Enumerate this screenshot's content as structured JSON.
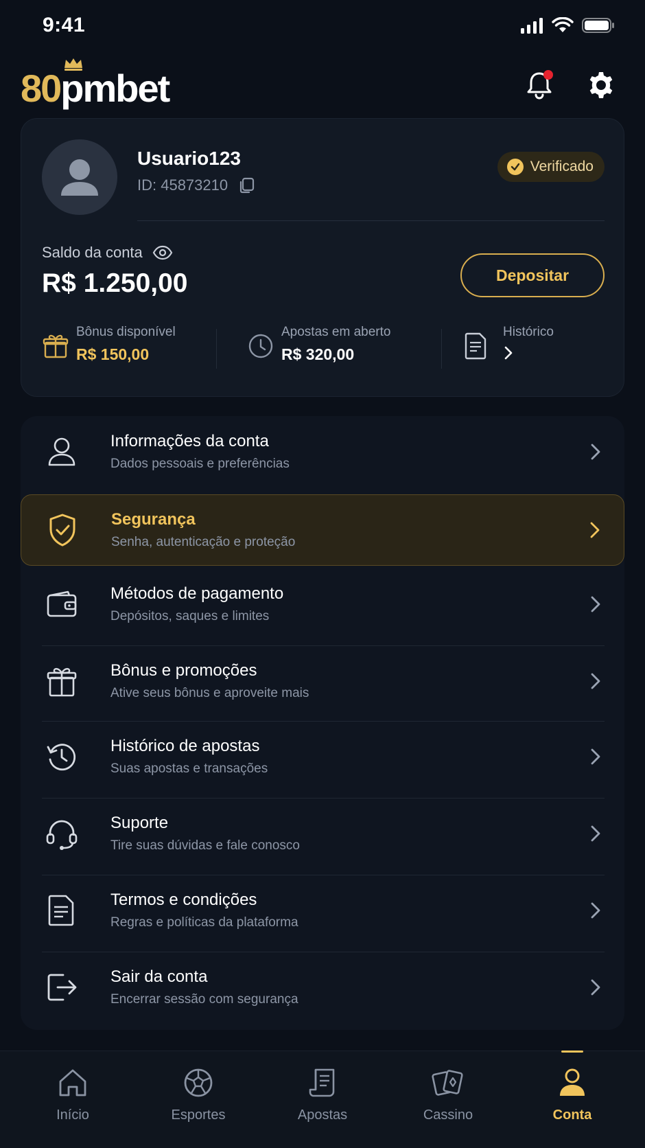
{
  "status_bar": {
    "time": "9:41"
  },
  "header": {
    "logo_num": "80",
    "logo_rest": "pmbet",
    "icons": [
      "bell-icon",
      "gear-icon"
    ],
    "notification_dot_color": "#e5232f"
  },
  "profile": {
    "username": "Usuario123",
    "id_text": "ID: 45873210",
    "verified_label": "Verificado",
    "balance_label": "Saldo da conta",
    "balance_value": "R$ 1.250,00",
    "deposit_label": "Depositar",
    "stats": [
      {
        "label": "Bônus disponível",
        "value": "R$ 150,00",
        "icon": "gift-icon"
      },
      {
        "label": "Apostas em aberto",
        "value": "R$ 320,00",
        "icon": "clock-icon"
      },
      {
        "label": "Histórico",
        "value": "",
        "icon": "document-icon"
      }
    ]
  },
  "menu": {
    "items": [
      {
        "title": "Informações da conta",
        "subtitle": "Dados pessoais e preferências",
        "icon": "user-icon",
        "active": false
      },
      {
        "title": "Segurança",
        "subtitle": "Senha, autenticação e proteção",
        "icon": "shield-check-icon",
        "active": true
      },
      {
        "title": "Métodos de pagamento",
        "subtitle": "Depósitos, saques e limites",
        "icon": "wallet-icon",
        "active": false
      },
      {
        "title": "Bônus e promoções",
        "subtitle": "Ative seus bônus e aproveite mais",
        "icon": "gift-icon",
        "active": false
      },
      {
        "title": "Histórico de apostas",
        "subtitle": "Suas apostas e transações",
        "icon": "history-icon",
        "active": false
      },
      {
        "title": "Suporte",
        "subtitle": "Tire suas dúvidas e fale conosco",
        "icon": "headset-icon",
        "active": false
      },
      {
        "title": "Termos e condições",
        "subtitle": "Regras e políticas da plataforma",
        "icon": "terms-icon",
        "active": false
      },
      {
        "title": "Sair da conta",
        "subtitle": "Encerrar sessão com segurança",
        "icon": "logout-icon",
        "active": false
      }
    ]
  },
  "tab_bar": {
    "tabs": [
      {
        "label": "Início",
        "icon": "home-icon",
        "active": false
      },
      {
        "label": "Esportes",
        "icon": "soccer-ball-icon",
        "active": false
      },
      {
        "label": "Apostas",
        "icon": "bet-slip-icon",
        "active": false
      },
      {
        "label": "Cassino",
        "icon": "cards-icon",
        "active": false
      },
      {
        "label": "Conta",
        "icon": "user-icon",
        "active": true
      }
    ]
  },
  "colors": {
    "accent": "#f1c45c",
    "background": "#0b1019",
    "card": "#121924"
  }
}
